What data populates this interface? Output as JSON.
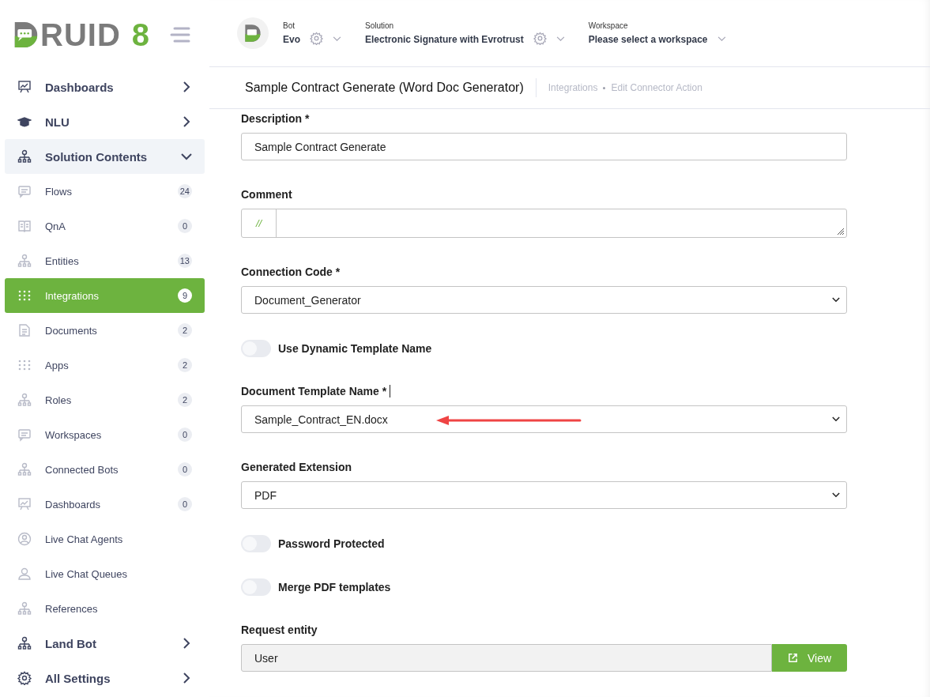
{
  "logo": {
    "text": "RUID",
    "version": "8"
  },
  "header": {
    "selectors": [
      {
        "label": "Bot",
        "value": "Evo",
        "gear": true
      },
      {
        "label": "Solution",
        "value": "Electronic Signature with Evrotrust",
        "gear": true
      },
      {
        "label": "Workspace",
        "value": "Please select a workspace",
        "gear": false
      }
    ]
  },
  "sidebar": {
    "items": [
      {
        "kind": "section",
        "label": "Dashboards",
        "expanded": false
      },
      {
        "kind": "section",
        "label": "NLU",
        "expanded": false
      },
      {
        "kind": "section",
        "label": "Solution Contents",
        "expanded": true
      },
      {
        "kind": "item",
        "label": "Flows",
        "count": "24",
        "selected": false
      },
      {
        "kind": "item",
        "label": "QnA",
        "count": "0",
        "selected": false
      },
      {
        "kind": "item",
        "label": "Entities",
        "count": "13",
        "selected": false
      },
      {
        "kind": "item",
        "label": "Integrations",
        "count": "9",
        "selected": true
      },
      {
        "kind": "item",
        "label": "Documents",
        "count": "2",
        "selected": false
      },
      {
        "kind": "item",
        "label": "Apps",
        "count": "2",
        "selected": false
      },
      {
        "kind": "item",
        "label": "Roles",
        "count": "2",
        "selected": false
      },
      {
        "kind": "item",
        "label": "Workspaces",
        "count": "0",
        "selected": false
      },
      {
        "kind": "item",
        "label": "Connected Bots",
        "count": "0",
        "selected": false
      },
      {
        "kind": "item",
        "label": "Dashboards",
        "count": "0",
        "selected": false
      },
      {
        "kind": "item",
        "label": "Live Chat Agents",
        "selected": false
      },
      {
        "kind": "item",
        "label": "Live Chat Queues",
        "selected": false
      },
      {
        "kind": "item",
        "label": "References",
        "selected": false
      },
      {
        "kind": "section",
        "label": "Land Bot",
        "expanded": false
      },
      {
        "kind": "section",
        "label": "All Settings",
        "expanded": false
      }
    ]
  },
  "page": {
    "title": "Sample Contract Generate (Word Doc Generator)",
    "breadcrumb": [
      "Integrations",
      "Edit Connector Action"
    ]
  },
  "form": [
    {
      "kind": "text",
      "label": "Description *",
      "value": "Sample Contract Generate"
    },
    {
      "kind": "comment",
      "label": "Comment",
      "prefix": "//"
    },
    {
      "kind": "select",
      "label": "Connection Code *",
      "value": "Document_Generator"
    },
    {
      "kind": "toggle",
      "label": "Use Dynamic Template Name",
      "on": false
    },
    {
      "kind": "select",
      "label": "Document Template Name *",
      "value": "Sample_Contract_EN.docx",
      "annotated": true
    },
    {
      "kind": "select",
      "label": "Generated Extension",
      "value": "PDF"
    },
    {
      "kind": "toggle",
      "label": "Password Protected",
      "on": false
    },
    {
      "kind": "toggle",
      "label": "Merge PDF templates",
      "on": false
    },
    {
      "kind": "entity",
      "label": "Request entity",
      "value": "User",
      "button": "View"
    }
  ]
}
